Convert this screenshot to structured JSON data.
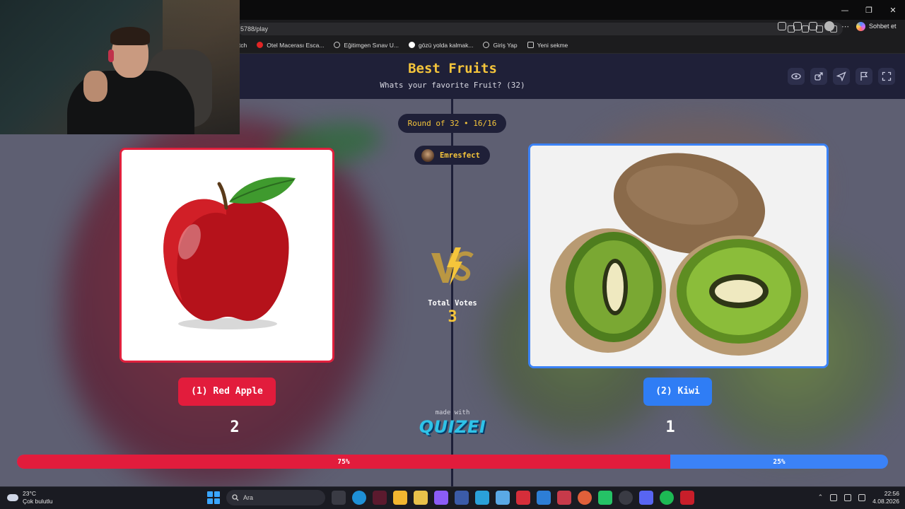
{
  "browser": {
    "url": "5788/play",
    "bookmarks": [
      "itch",
      "Otel Macerası Esca...",
      "Eğitimgen Sınav U...",
      "gözü yolda kalmak...",
      "Giriş Yap",
      "Yeni sekme"
    ],
    "copilot_label": "Sohbet et"
  },
  "app": {
    "title": "Best Fruits",
    "subtitle": "Whats your favorite Fruit? (32)",
    "round_label": "Round of 32 • 16/16",
    "user_name": "Emresfect",
    "total_votes_label": "Total Votes",
    "total_votes": "3",
    "made_with": "made with",
    "brand": "QUIZEI",
    "colors": {
      "left_accent": "#e21c3c",
      "right_accent": "#2f7df5",
      "title": "#f5c53b",
      "header_bg": "#1f2038"
    },
    "header_tools": [
      "eye-icon",
      "share-icon",
      "send-icon",
      "flag-icon",
      "fullscreen-icon"
    ]
  },
  "left": {
    "label": "(1) Red Apple",
    "votes": "2",
    "percent_label": "75%",
    "percent": 0.75,
    "image": "red-apple-image"
  },
  "right": {
    "label": "(2) Kiwi",
    "votes": "1",
    "percent_label": "25%",
    "percent": 0.25,
    "image": "kiwi-image"
  },
  "taskbar": {
    "temperature": "23°C",
    "weather": "Çok bulutlu",
    "search_placeholder": "Ara",
    "time": "22:56",
    "date": "4.08.2026"
  }
}
